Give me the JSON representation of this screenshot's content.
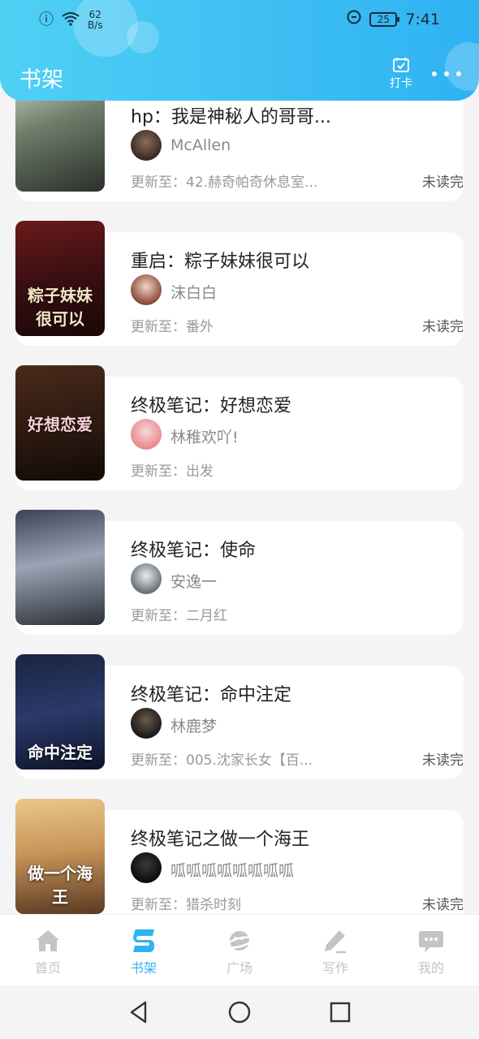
{
  "status_bar": {
    "net_speed": "62\nB/s",
    "battery": "25",
    "time": "7:41"
  },
  "header": {
    "title": "书架",
    "checkin_label": "打卡"
  },
  "books": [
    {
      "title": "hp：我是神秘人的哥哥...",
      "author": "McAllen",
      "update": "更新至：42.赫奇帕奇休息室...",
      "status": "未读完",
      "cover_text": ""
    },
    {
      "title": "重启：粽子妹妹很可以",
      "author": "沫白白",
      "update": "更新至：番外",
      "status": "未读完",
      "cover_text": "粽子妹妹 很可以"
    },
    {
      "title": "终极笔记：好想恋爱",
      "author": "林稚欢吖!",
      "update": "更新至：出发",
      "status": "",
      "cover_text": "好想恋爱"
    },
    {
      "title": "终极笔记：使命",
      "author": "安逸一",
      "update": "更新至：二月红",
      "status": "",
      "cover_text": ""
    },
    {
      "title": "终极笔记：命中注定",
      "author": "林鹿梦",
      "update": "更新至：005.沈家长女【百...",
      "status": "未读完",
      "cover_text": "命中注定"
    },
    {
      "title": "终极笔记之做一个海王",
      "author": "呱呱呱呱呱呱呱呱",
      "update": "更新至：猎杀时刻",
      "status": "未读完",
      "cover_text": "做一个海王"
    }
  ],
  "tabs": [
    {
      "label": "首页",
      "icon": "home-icon"
    },
    {
      "label": "书架",
      "icon": "bookshelf-icon"
    },
    {
      "label": "广场",
      "icon": "planet-icon"
    },
    {
      "label": "写作",
      "icon": "pen-icon"
    },
    {
      "label": "我的",
      "icon": "chat-bubble-icon"
    }
  ],
  "colors": {
    "accent": "#2fb2f2",
    "header_start": "#4fd0f5"
  }
}
